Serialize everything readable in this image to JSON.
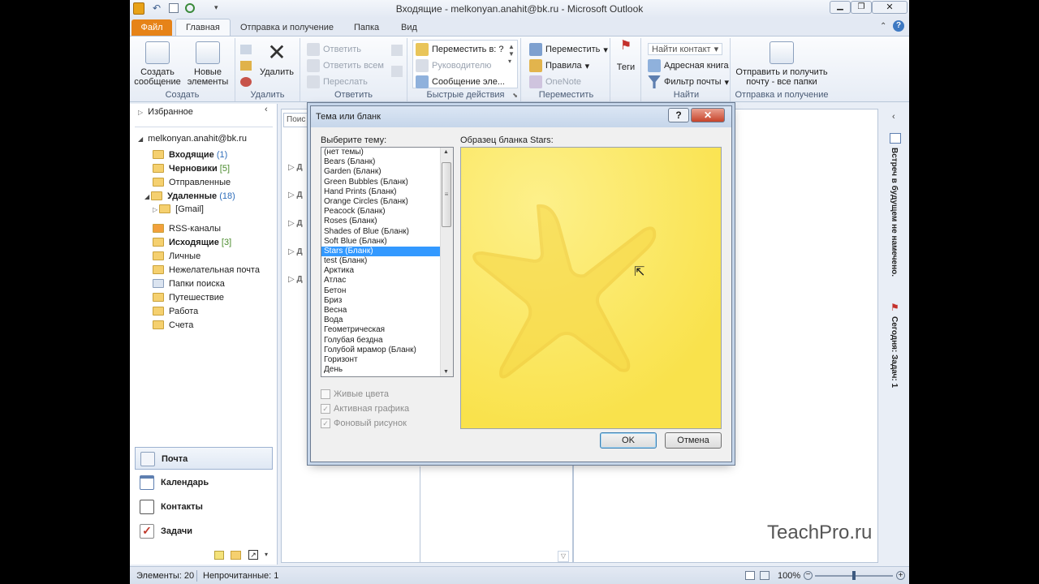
{
  "window": {
    "title": "Входящие - melkonyan.anahit@bk.ru - Microsoft Outlook"
  },
  "tabs": [
    "Файл",
    "Главная",
    "Отправка и получение",
    "Папка",
    "Вид"
  ],
  "ribbon": {
    "create": {
      "new_message": "Создать сообщение",
      "new_items": "Новые элементы",
      "group": "Создать"
    },
    "delete": {
      "delete": "Удалить",
      "group": "Удалить"
    },
    "respond": {
      "reply": "Ответить",
      "reply_all": "Ответить всем",
      "forward": "Переслать",
      "group": "Ответить"
    },
    "quick_steps": {
      "move_to": "Переместить в: ?",
      "manager": "Руководителю",
      "team_email": "Сообщение эле...",
      "group": "Быстрые действия"
    },
    "move": {
      "move": "Переместить",
      "rules": "Правила",
      "onenote": "OneNote",
      "group": "Переместить"
    },
    "tags": {
      "tags": "Теги"
    },
    "find": {
      "find_contact": "Найти контакт",
      "address_book": "Адресная книга",
      "filter_email": "Фильтр почты",
      "group": "Найти"
    },
    "send_receive": {
      "send_receive_all": "Отправить и получить почту - все папки",
      "group": "Отправка и получение"
    }
  },
  "nav": {
    "favorites": "Избранное",
    "account": "melkonyan.anahit@bk.ru",
    "folders": [
      {
        "name": "Входящие",
        "count": "(1)",
        "bold": true
      },
      {
        "name": "Черновики",
        "count": "[5]",
        "bold": true
      },
      {
        "name": "Отправленные",
        "count": "",
        "bold": false
      },
      {
        "name": "Удаленные",
        "count": "(18)",
        "bold": true
      },
      {
        "name": "[Gmail]",
        "count": "",
        "bold": false
      },
      {
        "name": "RSS-каналы",
        "count": "",
        "bold": false
      },
      {
        "name": "Исходящие",
        "count": "[3]",
        "bold": true
      },
      {
        "name": "Личные",
        "count": "",
        "bold": false
      },
      {
        "name": "Нежелательная почта",
        "count": "",
        "bold": false
      },
      {
        "name": "Папки поиска",
        "count": "",
        "bold": false
      },
      {
        "name": "Путешествие",
        "count": "",
        "bold": false
      },
      {
        "name": "Работа",
        "count": "",
        "bold": false
      },
      {
        "name": "Счета",
        "count": "",
        "bold": false
      }
    ],
    "modules": [
      "Почта",
      "Календарь",
      "Контакты",
      "Задачи"
    ]
  },
  "mid": {
    "search_placeholder": "Поис"
  },
  "todo": {
    "appointments": "Встреч в будущем не намечено.",
    "today": "Сегодня: Задач: 1"
  },
  "status": {
    "items": "Элементы: 20",
    "unread": "Непрочитанные: 1",
    "zoom": "100%"
  },
  "dialog": {
    "title": "Тема или бланк",
    "choose_label": "Выберите тему:",
    "preview_label": "Образец бланка Stars:",
    "themes": [
      "(нет темы)",
      "Bears (Бланк)",
      "Garden (Бланк)",
      "Green Bubbles (Бланк)",
      "Hand Prints (Бланк)",
      "Orange Circles (Бланк)",
      "Peacock (Бланк)",
      "Roses (Бланк)",
      "Shades of Blue (Бланк)",
      "Soft Blue (Бланк)",
      "Stars (Бланк)",
      "test (Бланк)",
      "Арктика",
      "Атлас",
      "Бетон",
      "Бриз",
      "Весна",
      "Вода",
      "Геометрическая",
      "Голубая бездна",
      "Голубой мрамор (Бланк)",
      "Горизонт",
      "День"
    ],
    "selected_theme": "Stars (Бланк)",
    "options": [
      {
        "label": "Живые цвета",
        "checked": false
      },
      {
        "label": "Активная графика",
        "checked": true
      },
      {
        "label": "Фоновый рисунок",
        "checked": true
      }
    ],
    "ok": "OK",
    "cancel": "Отмена",
    "help": "?",
    "close": "✕"
  },
  "watermark": "TeachPro.ru",
  "colors": {
    "accent": "#e68318",
    "selection": "#3399ff",
    "preview": "#fbe658"
  }
}
